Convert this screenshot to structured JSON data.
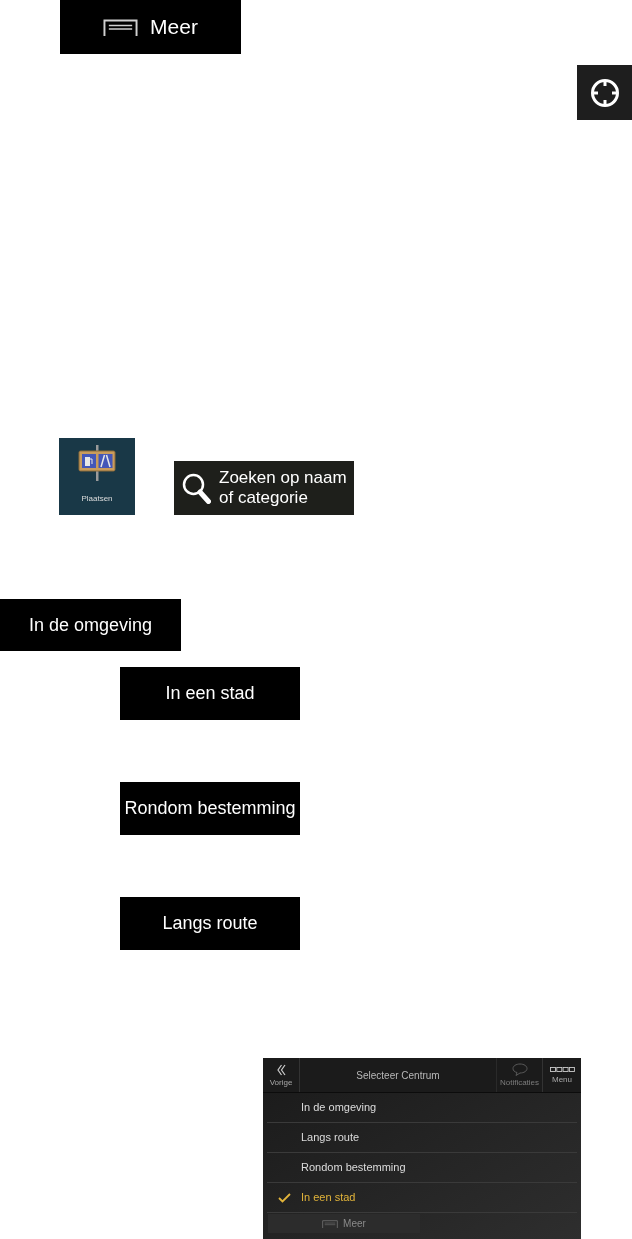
{
  "more_button": {
    "label": "Meer"
  },
  "places_tile": {
    "label": "Plaatsen"
  },
  "search_button": {
    "label": "Zoeken op naam of categorie"
  },
  "nearby_button": {
    "label": "In de omgeving"
  },
  "option_buttons": [
    {
      "label": "In een stad"
    },
    {
      "label": "Rondom bestemming"
    },
    {
      "label": "Langs route"
    }
  ],
  "screenshot": {
    "back_label": "Vorige",
    "title": "Selecteer Centrum",
    "notifications": {
      "label": "Notificaties",
      "disabled": true
    },
    "menu_label": "Menu",
    "options": [
      {
        "label": "In de omgeving",
        "selected": false
      },
      {
        "label": "Langs route",
        "selected": false
      },
      {
        "label": "Rondom bestemming",
        "selected": false
      },
      {
        "label": "In een stad",
        "selected": true
      }
    ],
    "more_button": {
      "label": "Meer",
      "disabled": true
    }
  }
}
